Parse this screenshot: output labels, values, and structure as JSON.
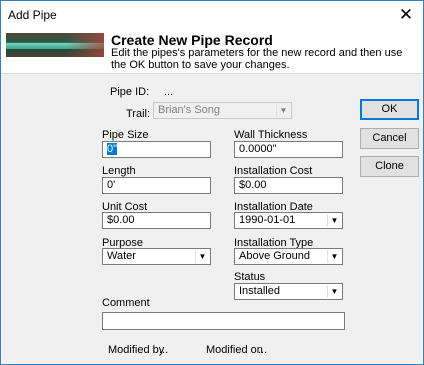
{
  "window": {
    "title": "Add Pipe",
    "close_glyph": "✕"
  },
  "header": {
    "title": "Create New Pipe Record",
    "description": "Edit the pipes's parameters for the new record and then use the OK button to save your changes."
  },
  "form": {
    "pipe_id_label": "Pipe ID:",
    "pipe_id_value": "...",
    "trail_label": "Trail:",
    "trail_value": "Brian's Song",
    "pipe_size_label": "Pipe Size",
    "pipe_size_value": "0\"",
    "wall_thickness_label": "Wall Thickness",
    "wall_thickness_value": "0.0000\"",
    "length_label": "Length",
    "length_value": "0'",
    "installation_cost_label": "Installation Cost",
    "installation_cost_value": "$0.00",
    "unit_cost_label": "Unit Cost",
    "unit_cost_value": "$0.00",
    "installation_date_label": "Installation Date",
    "installation_date_value": "1990-01-01",
    "purpose_label": "Purpose",
    "purpose_value": "Water",
    "installation_type_label": "Installation Type",
    "installation_type_value": "Above Ground",
    "status_label": "Status",
    "status_value": "Installed",
    "comment_label": "Comment",
    "comment_value": "",
    "modified_by_label": "Modified by",
    "modified_by_value": "...",
    "modified_on_label": "Modified on",
    "modified_on_value": "..."
  },
  "buttons": {
    "ok": "OK",
    "cancel": "Cancel",
    "clone": "Clone"
  },
  "icons": {
    "dropdown": "chevron-down-icon",
    "close": "close-icon"
  }
}
